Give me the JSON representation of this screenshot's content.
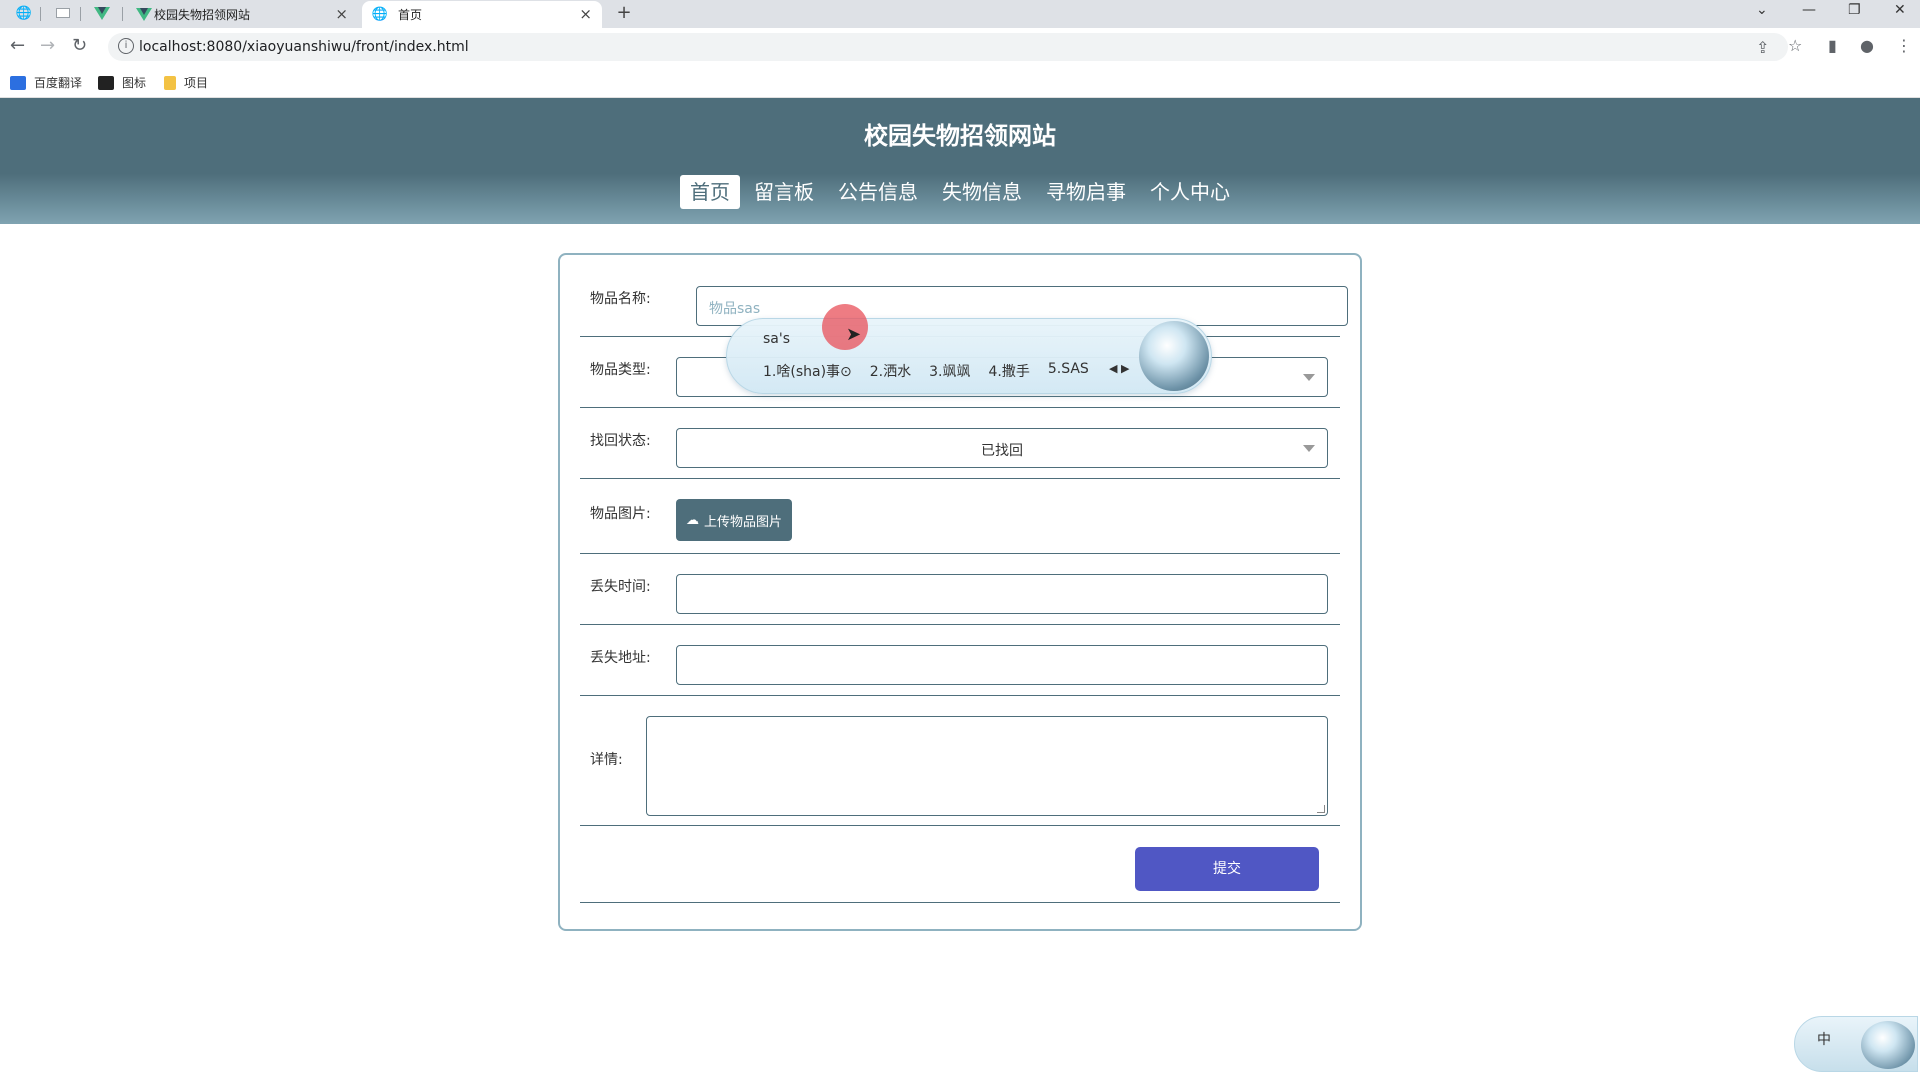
{
  "browser": {
    "tabs": [
      {
        "label": "",
        "icon": "globe-icon"
      },
      {
        "label": "",
        "icon": "blank-page-icon"
      },
      {
        "label": "",
        "icon": "vue-icon"
      },
      {
        "label": "校园失物招领网站",
        "icon": "vue-icon"
      },
      {
        "label": "首页",
        "icon": "globe-icon"
      }
    ],
    "url": "localhost:8080/xiaoyuanshiwu/front/index.html",
    "bookmarks": [
      {
        "label": "百度翻译",
        "color": "#2c6fe0"
      },
      {
        "label": "图标",
        "color": "#222222"
      },
      {
        "label": "项目",
        "color": "#f3c244"
      }
    ]
  },
  "site": {
    "title": "校园失物招领网站",
    "nav": [
      "首页",
      "留言板",
      "公告信息",
      "失物信息",
      "寻物启事",
      "个人中心"
    ],
    "active_nav": "首页"
  },
  "form": {
    "name_label": "物品名称:",
    "name_value": "物品sas",
    "type_label": "物品类型:",
    "type_value": "",
    "status_label": "找回状态:",
    "status_value": "已找回",
    "image_label": "物品图片:",
    "upload_label": "上传物品图片",
    "lost_time_label": "丢失时间:",
    "lost_address_label": "丢失地址:",
    "detail_label": "详情:",
    "submit_label": "提交"
  },
  "ime": {
    "composition": "sa's",
    "candidates": [
      "1.啥(sha)事⊙",
      "2.洒水",
      "3.飒飒",
      "4.撒手",
      "5.SAS"
    ],
    "status_char": "中"
  },
  "colors": {
    "header": "#4e6e7b",
    "submit": "#5057c4",
    "accent": "#8fb2c0"
  }
}
